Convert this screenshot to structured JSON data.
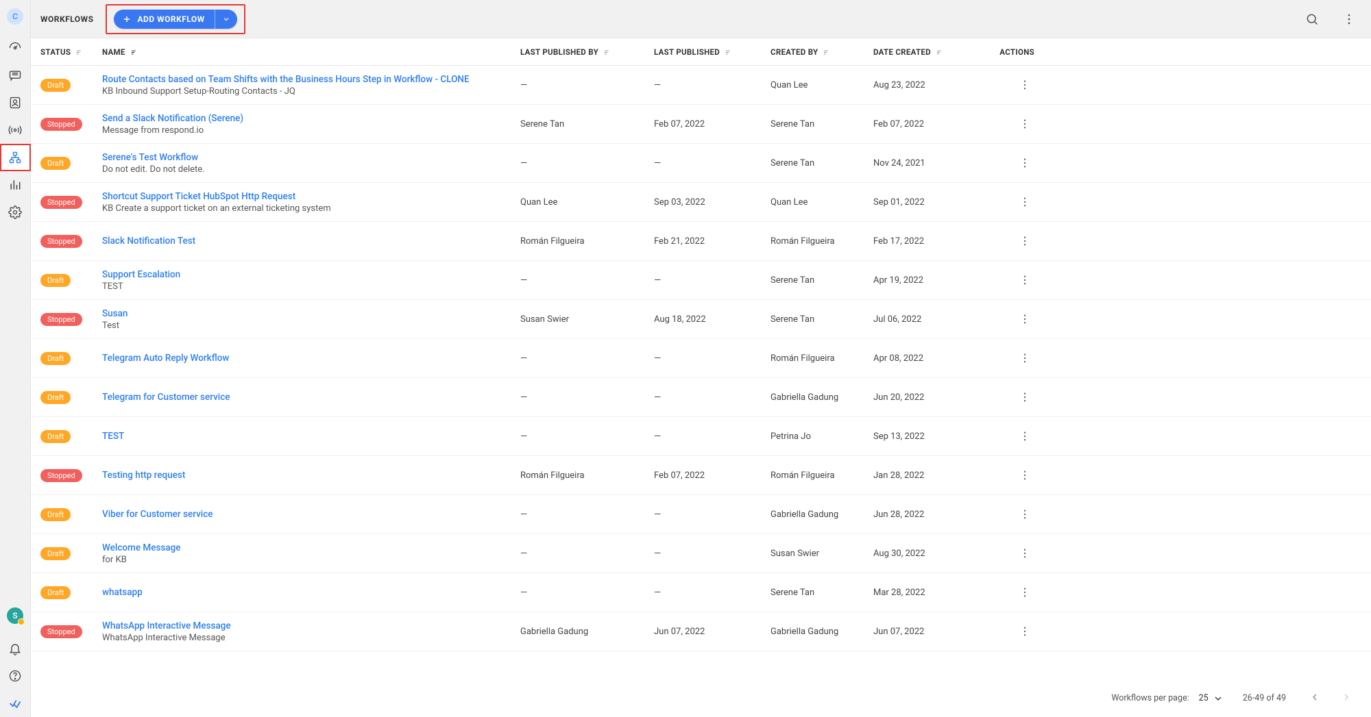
{
  "app": {
    "avatar_letter": "C",
    "user_letter": "S"
  },
  "header": {
    "title": "WORKFLOWS",
    "add_label": "ADD WORKFLOW"
  },
  "columns": {
    "status": "STATUS",
    "name": "NAME",
    "last_published_by": "LAST PUBLISHED BY",
    "last_published": "LAST PUBLISHED",
    "created_by": "CREATED BY",
    "date_created": "DATE CREATED",
    "actions": "ACTIONS"
  },
  "rows": [
    {
      "status": "Draft",
      "name": "Route Contacts based on Team Shifts with the Business Hours Step in Workflow - CLONE",
      "desc": "KB Inbound Support Setup-Routing Contacts - JQ",
      "lpb": "—",
      "lp": "—",
      "cb": "Quan Lee",
      "dc": "Aug 23, 2022"
    },
    {
      "status": "Stopped",
      "name": "Send a Slack Notification (Serene)",
      "desc": "Message from respond.io",
      "lpb": "Serene Tan",
      "lp": "Feb 07, 2022",
      "cb": "Serene Tan",
      "dc": "Feb 07, 2022"
    },
    {
      "status": "Draft",
      "name": "Serene's Test Workflow",
      "desc": "Do not edit. Do not delete.",
      "lpb": "—",
      "lp": "—",
      "cb": "Serene Tan",
      "dc": "Nov 24, 2021"
    },
    {
      "status": "Stopped",
      "name": "Shortcut Support Ticket HubSpot Http Request",
      "desc": "KB Create a support ticket on an external ticketing system",
      "lpb": "Quan Lee",
      "lp": "Sep 03, 2022",
      "cb": "Quan Lee",
      "dc": "Sep 01, 2022"
    },
    {
      "status": "Stopped",
      "name": "Slack Notification Test",
      "desc": "",
      "lpb": "Román Filgueira",
      "lp": "Feb 21, 2022",
      "cb": "Román Filgueira",
      "dc": "Feb 17, 2022"
    },
    {
      "status": "Draft",
      "name": "Support Escalation",
      "desc": "TEST",
      "lpb": "—",
      "lp": "—",
      "cb": "Serene Tan",
      "dc": "Apr 19, 2022"
    },
    {
      "status": "Stopped",
      "name": "Susan",
      "desc": "Test",
      "lpb": "Susan Swier",
      "lp": "Aug 18, 2022",
      "cb": "Serene Tan",
      "dc": "Jul 06, 2022"
    },
    {
      "status": "Draft",
      "name": "Telegram Auto Reply Workflow",
      "desc": "",
      "lpb": "—",
      "lp": "—",
      "cb": "Román Filgueira",
      "dc": "Apr 08, 2022"
    },
    {
      "status": "Draft",
      "name": "Telegram for Customer service",
      "desc": "",
      "lpb": "—",
      "lp": "—",
      "cb": "Gabriella Gadung",
      "dc": "Jun 20, 2022"
    },
    {
      "status": "Draft",
      "name": "TEST",
      "desc": "",
      "lpb": "—",
      "lp": "—",
      "cb": "Petrina Jo",
      "dc": "Sep 13, 2022"
    },
    {
      "status": "Stopped",
      "name": "Testing http request",
      "desc": "",
      "lpb": "Román Filgueira",
      "lp": "Feb 07, 2022",
      "cb": "Román Filgueira",
      "dc": "Jan 28, 2022"
    },
    {
      "status": "Draft",
      "name": "Viber for Customer service",
      "desc": "",
      "lpb": "—",
      "lp": "—",
      "cb": "Gabriella Gadung",
      "dc": "Jun 28, 2022"
    },
    {
      "status": "Draft",
      "name": "Welcome Message",
      "desc": "for KB",
      "lpb": "—",
      "lp": "—",
      "cb": "Susan Swier",
      "dc": "Aug 30, 2022"
    },
    {
      "status": "Draft",
      "name": "whatsapp",
      "desc": "",
      "lpb": "—",
      "lp": "—",
      "cb": "Serene Tan",
      "dc": "Mar 28, 2022"
    },
    {
      "status": "Stopped",
      "name": "WhatsApp Interactive Message",
      "desc": "WhatsApp Interactive Message",
      "lpb": "Gabriella Gadung",
      "lp": "Jun 07, 2022",
      "cb": "Gabriella Gadung",
      "dc": "Jun 07, 2022"
    }
  ],
  "footer": {
    "per_page_label": "Workflows per page:",
    "per_page_value": "25",
    "range": "26-49 of 49"
  }
}
